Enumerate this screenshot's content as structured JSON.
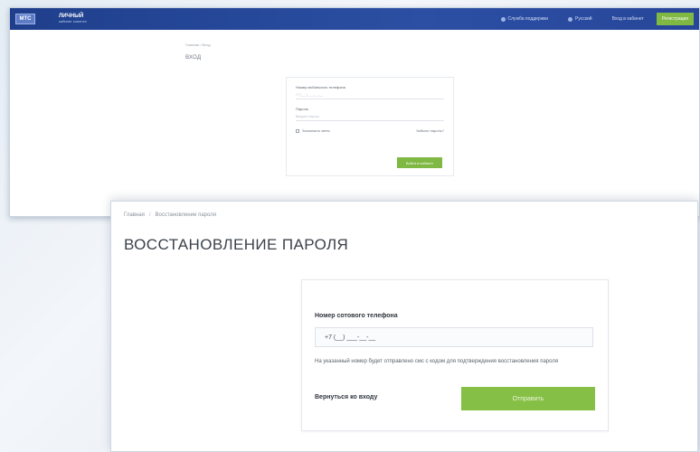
{
  "login_window": {
    "logo_badge": "МТС",
    "logo_title": "ЛИЧНЫЙ",
    "logo_subtitle": "кабинет клиента",
    "nav": {
      "support": "Служба поддержки",
      "language": "Русский",
      "login": "Вход в кабинет",
      "register": "Регистрация"
    },
    "breadcrumb": "Главная / Вход",
    "title": "ВХОД",
    "form": {
      "phone_label": "Номер мобильного телефона",
      "phone_placeholder": "+7 (___) ___-__-__",
      "password_label": "Пароль",
      "password_placeholder": "Введите пароль",
      "remember_label": "Запомнить меня",
      "forgot_link": "Забыли пароль?",
      "submit_label": "Войти в кабинет"
    }
  },
  "recovery_window": {
    "breadcrumb": {
      "home": "Главная",
      "separator": "/",
      "current": "Восстановление пароля"
    },
    "title": "ВОССТАНОВЛЕНИЕ ПАРОЛЯ",
    "form": {
      "phone_label": "Номер сотового телефона",
      "phone_value": "+7 (__) ___-__-__",
      "info_text": "На указанный номер будет отправлено смс с кодом для подтверждения восстановления пароля",
      "back_link": "Вернуться ко входу",
      "send_button": "Отправить"
    }
  },
  "colors": {
    "topbar": "#27469a",
    "accent_green": "#86bf45",
    "title_text": "#3b424b"
  }
}
